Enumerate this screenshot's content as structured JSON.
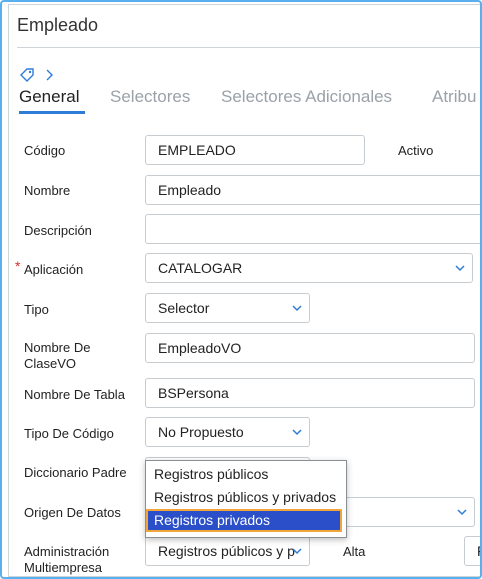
{
  "header": {
    "title": "Empleado"
  },
  "tabs": [
    {
      "label": "General"
    },
    {
      "label": "Selectores"
    },
    {
      "label": "Selectores Adicionales"
    },
    {
      "label": "Atribu"
    }
  ],
  "form": {
    "codigo": {
      "label": "Código",
      "value": "EMPLEADO"
    },
    "activo": {
      "label": "Activo"
    },
    "nombre": {
      "label": "Nombre",
      "value": "Empleado"
    },
    "descripcion": {
      "label": "Descripción",
      "value": ""
    },
    "aplicacion": {
      "label": "Aplicación",
      "required_mark": "*",
      "value": "CATALOGAR"
    },
    "tipo": {
      "label": "Tipo",
      "value": "Selector"
    },
    "clase_vo": {
      "label_line1": "Nombre De",
      "label_line2": "ClaseVO",
      "value": "EmpleadoVO"
    },
    "tabla": {
      "label": "Nombre De Tabla",
      "value": "BSPersona"
    },
    "tipo_codigo": {
      "label": "Tipo De Código",
      "value": "No Propuesto"
    },
    "diccionario": {
      "label": "Diccionario Padre"
    },
    "origen": {
      "label": "Origen De Datos"
    },
    "multiempresa": {
      "label_line1": "Administración",
      "label_line2": "Multiempresa",
      "value": "Registros públicos y p",
      "side_label": "Alta",
      "side_value": "F"
    }
  },
  "dropdown": {
    "options": [
      {
        "label": "Registros públicos"
      },
      {
        "label": "Registros públicos y privados"
      },
      {
        "label": "Registros privados"
      }
    ],
    "selected": "Registros privados"
  },
  "colors": {
    "accent": "#2f7bd8",
    "selection": "#2a4fc8",
    "focus_outline": "#f0a63a",
    "required": "#d32f2f"
  }
}
